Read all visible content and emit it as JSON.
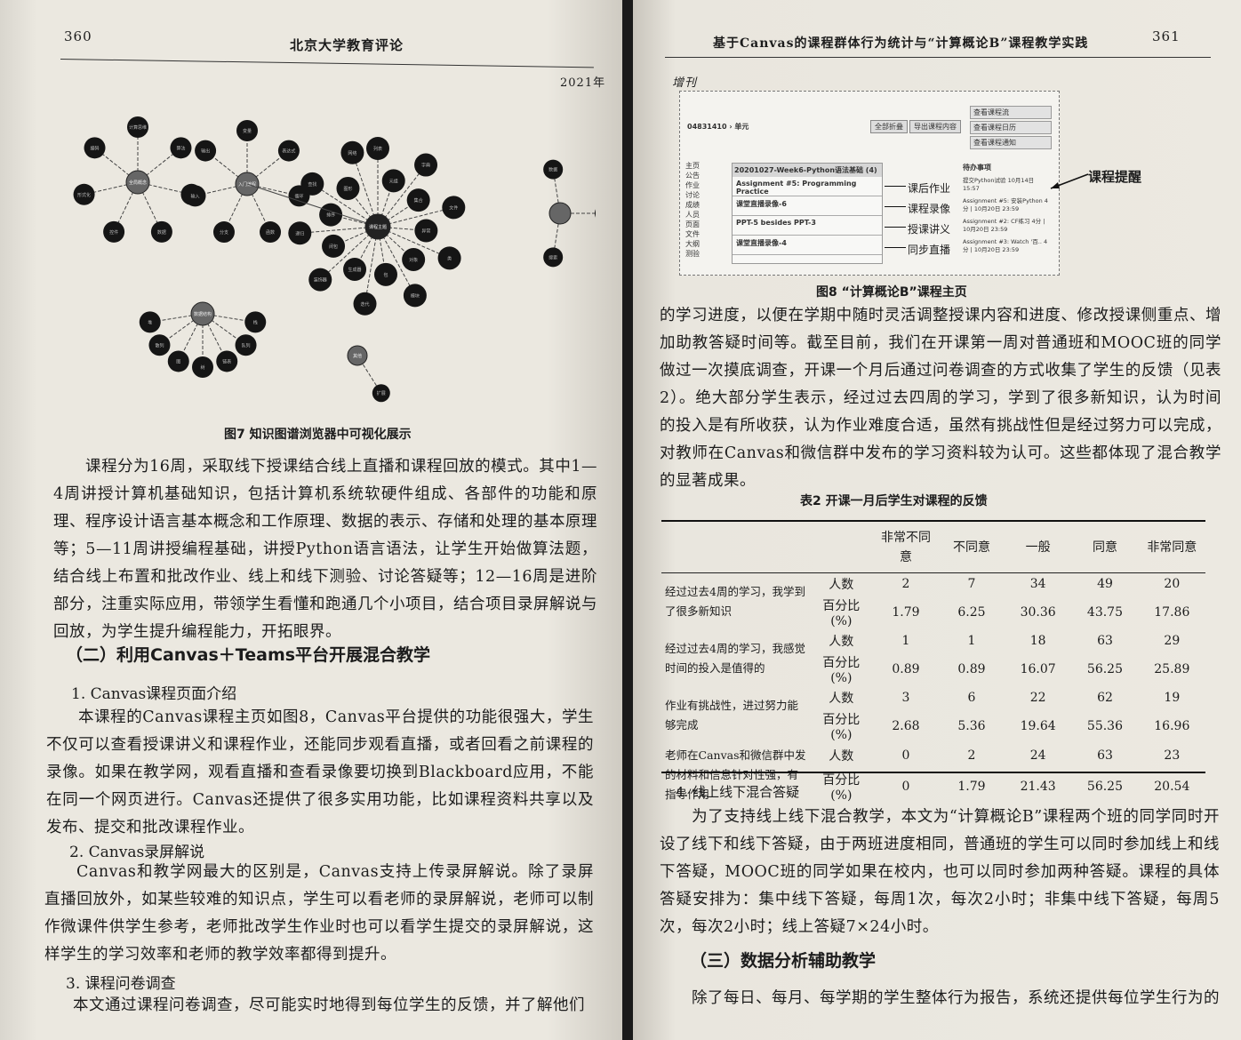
{
  "left_page": {
    "page_number": "360",
    "journal": "北京大学教育评论",
    "year": "2021年",
    "figure7": {
      "caption": "图7  知识图谱浏览器中可视化展示",
      "graph": {
        "clusters": [
          {
            "center": "全局概念",
            "children": [
              "计算思维",
              "算法",
              "程序",
              "数据",
              "控件",
              "形式化",
              "编码"
            ]
          },
          {
            "center": "入门编程",
            "children": [
              "变量",
              "表达式",
              "循环",
              "函数",
              "分支",
              "输入",
              "输出"
            ]
          },
          {
            "center": "课程主题",
            "children": [
              "列表",
              "元组",
              "字典",
              "集合",
              "文件",
              "异常",
              "类",
              "对象",
              "模块",
              "包",
              "迭代",
              "生成器",
              "装饰器",
              "闭包",
              "递归",
              "排序",
              "查找",
              "图形",
              "网络"
            ]
          },
          {
            "center": "",
            "children": [
              "数据",
              "网络",
              "搜索"
            ]
          },
          {
            "center": "数据结构",
            "children": [
              "栈",
              "队列",
              "链表",
              "树",
              "图",
              "散列",
              "堆"
            ]
          },
          {
            "center": "其他",
            "children": [
              "扩展"
            ]
          }
        ]
      }
    },
    "para1": "课程分为16周，采取线下授课结合线上直播和课程回放的模式。其中1—4周讲授计算机基础知识，包括计算机系统软硬件组成、各部件的功能和原理、程序设计语言基本概念和工作原理、数据的表示、存储和处理的基本原理等；5—11周讲授编程基础，讲授Python语言语法，让学生开始做算法题，结合线上布置和批改作业、线上和线下测验、讨论答疑等；12—16周是进阶部分，注重实际应用，带领学生看懂和跑通几个小项目，结合项目录屏解说与回放，为学生提升编程能力，开拓眼界。",
    "section2_title": "（二）利用Canvas＋Teams平台开展混合教学",
    "sub1": "1. Canvas课程页面介绍",
    "para2": "本课程的Canvas课程主页如图8，Canvas平台提供的功能很强大，学生不仅可以查看授课讲义和课程作业，还能同步观看直播，或者回看之前课程的录像。如果在教学网，观看直播和查看录像要切换到Blackboard应用，不能在同一个网页进行。Canvas还提供了很多实用功能，比如课程资料共享以及发布、提交和批改课程作业。",
    "sub2": "2. Canvas录屏解说",
    "para3": "Canvas和教学网最大的区别是，Canvas支持上传录屏解说。除了录屏直播回放外，如某些较难的知识点，学生可以看老师的录屏解说，老师可以制作微课件供学生参考，老师批改学生作业时也可以看学生提交的录屏解说，这样学生的学习效率和老师的教学效率都得到提升。",
    "sub3": "3. 课程问卷调查",
    "para4": "本文通过课程问卷调查，尽可能实时地得到每位学生的反馈，并了解他们"
  },
  "right_page": {
    "page_number": "361",
    "running_title": "基于Canvas的课程群体行为统计与“计算概论B”课程教学实践",
    "issue": "增刊",
    "figure8": {
      "caption": "图8  “计算概论B”课程主页",
      "course_id": "04831410 › 单元",
      "buttons": [
        "全部折叠",
        "导出课程内容"
      ],
      "nav_items": [
        "主页",
        "公告",
        "作业",
        "讨论",
        "成绩",
        "人员",
        "页面",
        "文件",
        "大纲",
        "测验"
      ],
      "module_title": "20201027-Week6-Python语法基础 (4)",
      "module_items": [
        "Assignment #5: Programming Practice",
        "课堂直播录像-6",
        "PPT-5 besides PPT-3",
        "课堂直播录像-4"
      ],
      "annotations": [
        "课后作业",
        "课程录像",
        "授课讲义",
        "同步直播"
      ],
      "side_buttons": [
        "查看课程流",
        "查看课程日历",
        "查看课程通知"
      ],
      "todo_title": "待办事项",
      "todo_items": [
        "提交Python试验 10月14日 15:57",
        "Assignment #5: 安装Python 4分 | 10月20日 23:59",
        "Assignment #2: CF练习 4分 | 10月20日 23:59",
        "Assignment #3: Watch '百.. 4分 | 10月20日 23:59"
      ],
      "reminder_label": "课程提醒"
    },
    "para1": "的学习进度，以便在学期中随时灵活调整授课内容和进度、修改授课侧重点、增加助教答疑时间等。截至目前，我们在开课第一周对普通班和MOOC班的同学做过一次摸底调查，开课一个月后通过问卷调查的方式收集了学生的反馈（见表2）。绝大部分学生表示，经过过去四周的学习，学到了很多新知识，认为时间的投入是有所收获，认为作业难度合适，虽然有挑战性但是经过努力可以完成，对教师在Canvas和微信群中发布的学习资料较为认可。这些都体现了混合教学的显著成果。",
    "table2": {
      "title": "表2  开课一月后学生对课程的反馈",
      "columns": [
        "非常不同意",
        "不同意",
        "一般",
        "同意",
        "非常同意"
      ],
      "rows": [
        {
          "question": "经过过去4周的学习，我学到了很多新知识",
          "count_label": "人数",
          "pct_label": "百分比(%)",
          "counts": [
            "2",
            "7",
            "34",
            "49",
            "20"
          ],
          "pcts": [
            "1.79",
            "6.25",
            "30.36",
            "43.75",
            "17.86"
          ]
        },
        {
          "question": "经过过去4周的学习，我感觉时间的投入是值得的",
          "count_label": "人数",
          "pct_label": "百分比(%)",
          "counts": [
            "1",
            "1",
            "18",
            "63",
            "29"
          ],
          "pcts": [
            "0.89",
            "0.89",
            "16.07",
            "56.25",
            "25.89"
          ]
        },
        {
          "question": "作业有挑战性，进过努力能够完成",
          "count_label": "人数",
          "pct_label": "百分比(%)",
          "counts": [
            "3",
            "6",
            "22",
            "62",
            "19"
          ],
          "pcts": [
            "2.68",
            "5.36",
            "19.64",
            "55.36",
            "16.96"
          ]
        },
        {
          "question": "老师在Canvas和微信群中发的材料和信息针对性强，有指导作用",
          "count_label": "人数",
          "pct_label": "百分比(%)",
          "counts": [
            "0",
            "2",
            "24",
            "63",
            "23"
          ],
          "pcts": [
            "0",
            "1.79",
            "21.43",
            "56.25",
            "20.54"
          ]
        }
      ]
    },
    "sub4": "4. 线上线下混合答疑",
    "para2": "为了支持线上线下混合教学，本文为“计算概论B”课程两个班的同学同时开设了线下和线下答疑，由于两班进度相同，普通班的学生可以同时参加线上和线下答疑，MOOC班的同学如果在校内，也可以同时参加两种答疑。课程的具体答疑安排为：集中线下答疑，每周1次，每次2小时；非集中线下答疑，每周5次，每次2小时；线上答疑7×24小时。",
    "section3_title": "（三）数据分析辅助教学",
    "para3": "除了每日、每月、每学期的学生整体行为报告，系统还提供每位学生行为的"
  }
}
